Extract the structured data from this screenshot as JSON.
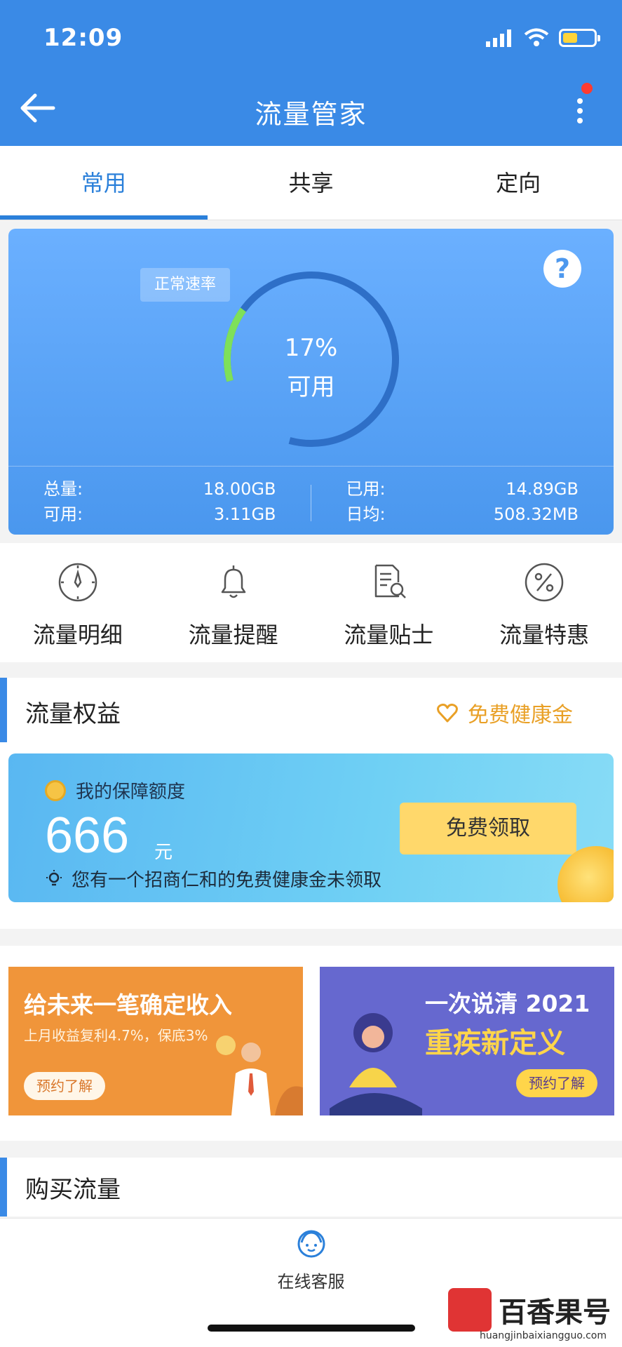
{
  "status": {
    "time": "12:09"
  },
  "header": {
    "title": "流量管家"
  },
  "tabs": [
    {
      "label": "常用",
      "active": true
    },
    {
      "label": "共享",
      "active": false
    },
    {
      "label": "定向",
      "active": false
    }
  ],
  "gauge": {
    "speed_badge": "正常速率",
    "percent_text": "17%",
    "available_label": "可用",
    "percent_value": 0.17,
    "stats": {
      "total_label": "总量:",
      "total_value": "18.00GB",
      "avail_label": "可用:",
      "avail_value": "3.11GB",
      "used_label": "已用:",
      "used_value": "14.89GB",
      "daily_label": "日均:",
      "daily_value": "508.32MB"
    }
  },
  "features": [
    {
      "label": "流量明细",
      "icon": "compass-icon"
    },
    {
      "label": "流量提醒",
      "icon": "bell-icon"
    },
    {
      "label": "流量贴士",
      "icon": "document-search-icon"
    },
    {
      "label": "流量特惠",
      "icon": "percent-icon"
    }
  ],
  "rights": {
    "title": "流量权益",
    "health_link": "免费健康金",
    "card": {
      "title": "我的保障额度",
      "amount": "666",
      "unit": "元",
      "tip": "您有一个招商仁和的免费健康金未领取",
      "button": "免费领取"
    }
  },
  "banners": {
    "left": {
      "title": "给未来一笔确定收入",
      "subtitle": "上月收益复利4.7%，保底3%",
      "button": "预约了解"
    },
    "right": {
      "title_line1": "一次说清 2021",
      "title_line2": "重疾新定义",
      "button": "预约了解"
    }
  },
  "buy": {
    "title": "购买流量"
  },
  "bottom": {
    "service_label": "在线客服"
  },
  "watermark": {
    "brand": "百香果号",
    "url": "huangjinbaixiangguo.com"
  },
  "colors": {
    "primary": "#3a8ae6",
    "gauge_used": "#2e6fc7",
    "gauge_avail": "#7ee05a",
    "accent_gold": "#e9a026"
  }
}
